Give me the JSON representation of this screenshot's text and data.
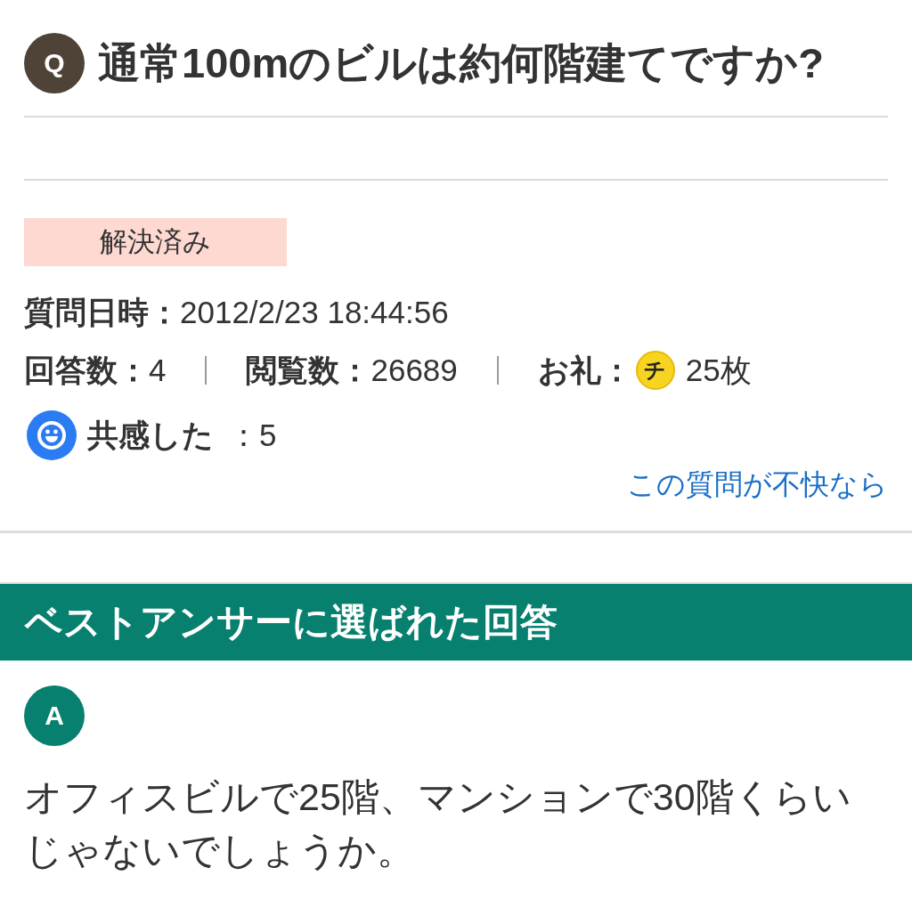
{
  "question": {
    "badge": "Q",
    "title": "通常100mのビルは約何階建てですか?"
  },
  "status_label": "解決済み",
  "posted": {
    "label": "質問日時：",
    "value": "2012/2/23 18:44:56"
  },
  "stats": [
    {
      "kind": "plain",
      "label": "回答数：",
      "value": "4"
    },
    {
      "kind": "plain",
      "label": "閲覧数：",
      "value": "26689"
    },
    {
      "kind": "coin",
      "label": "お礼：",
      "coin": "チ",
      "value": "25枚"
    }
  ],
  "empathy": {
    "label": "共感した",
    "value": "：5"
  },
  "report_link": "この質問が不快なら",
  "best_answer": {
    "heading": "ベストアンサーに選ばれた回答",
    "badge": "A",
    "text": "オフィスビルで25階、マンションで30階くらいじゃないでしょうか。"
  }
}
